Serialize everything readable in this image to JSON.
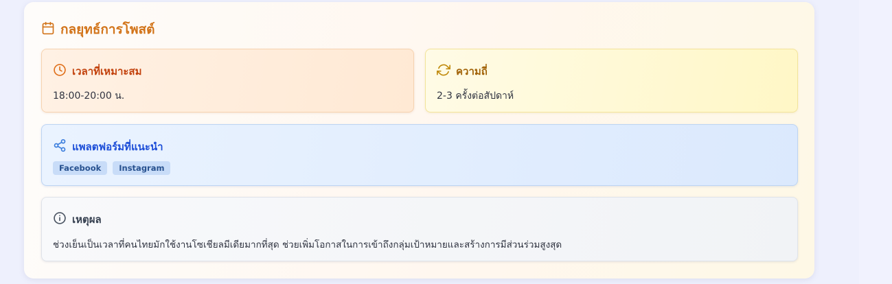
{
  "section": {
    "title": "กลยุทธ์การโพสต์",
    "title_icon": "calendar-icon",
    "accent_color": "#d2741a"
  },
  "best_time": {
    "label": "เวลาที่เหมาะสม",
    "icon": "clock-icon",
    "value": "18:00-20:00 น.",
    "color": "#c2410c"
  },
  "frequency": {
    "label": "ความถี่",
    "icon": "refresh-icon",
    "value": "2-3 ครั้งต่อสัปดาห์",
    "color": "#a16207"
  },
  "platforms": {
    "label": "แพลตฟอร์มที่แนะนำ",
    "icon": "share-icon",
    "color": "#1d4ed8",
    "items": [
      "Facebook",
      "Instagram"
    ]
  },
  "reason": {
    "label": "เหตุผล",
    "icon": "info-icon",
    "color": "#374151",
    "text": "ช่วงเย็นเป็นเวลาที่คนไทยมักใช้งานโซเชียลมีเดียมากที่สุด ช่วยเพิ่มโอกาสในการเข้าถึงกลุ่มเป้าหมายและสร้างการมีส่วนร่วมสูงสุด"
  }
}
